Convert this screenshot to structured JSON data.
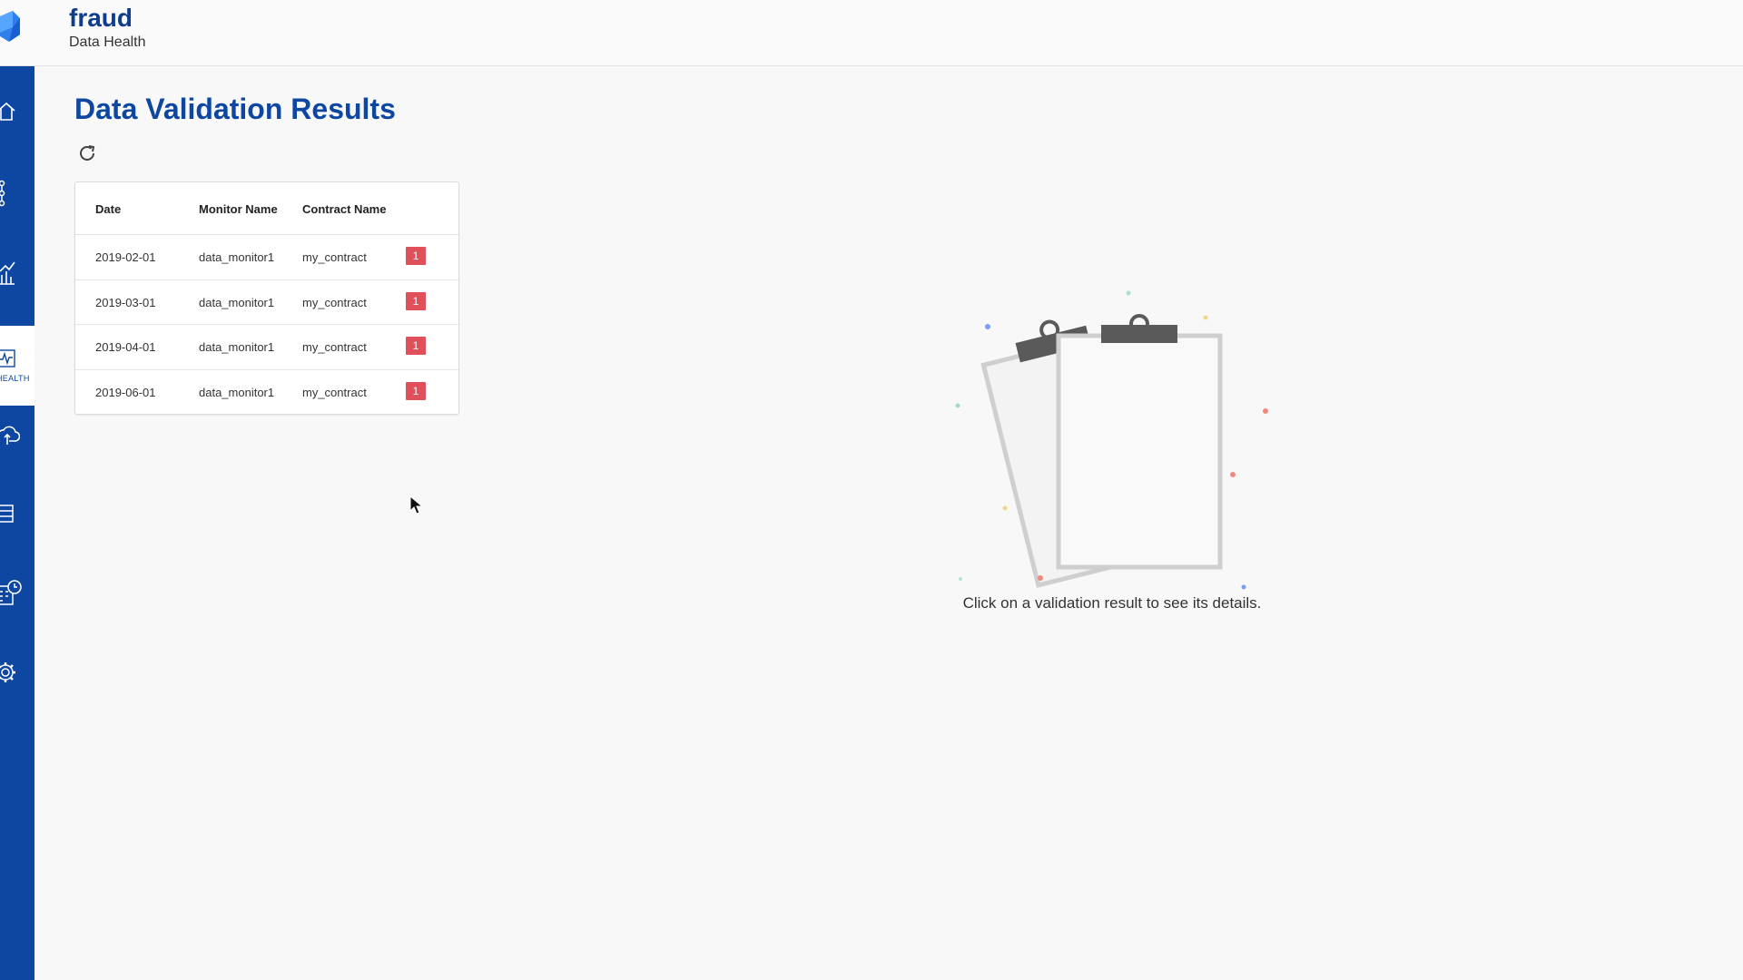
{
  "header": {
    "app_title": "fraud",
    "app_subtitle": "Data Health"
  },
  "sidebar": {
    "active_label": "HEALTH",
    "items": [
      {
        "icon": "home-icon"
      },
      {
        "icon": "network-icon"
      },
      {
        "icon": "chart-icon"
      },
      {
        "icon": "health-icon",
        "label": "HEALTH",
        "active": true
      },
      {
        "icon": "cloud-upload-icon"
      },
      {
        "icon": "list-icon"
      },
      {
        "icon": "schedule-icon"
      },
      {
        "icon": "gear-icon"
      }
    ]
  },
  "main": {
    "title": "Data Validation Results",
    "refresh_icon": "refresh-icon",
    "table": {
      "headers": [
        "Date",
        "Monitor Name",
        "Contract Name"
      ],
      "rows": [
        {
          "date": "2019-02-01",
          "monitor": "data_monitor1",
          "contract": "my_contract",
          "issues": "1"
        },
        {
          "date": "2019-03-01",
          "monitor": "data_monitor1",
          "contract": "my_contract",
          "issues": "1"
        },
        {
          "date": "2019-04-01",
          "monitor": "data_monitor1",
          "contract": "my_contract",
          "issues": "1"
        },
        {
          "date": "2019-06-01",
          "monitor": "data_monitor1",
          "contract": "my_contract",
          "issues": "1"
        }
      ]
    },
    "empty_state": {
      "message": "Click on a validation result to see its details."
    }
  },
  "colors": {
    "brand": "#0d47a1",
    "badge": "#e0505a",
    "background": "#f8f8f8"
  }
}
